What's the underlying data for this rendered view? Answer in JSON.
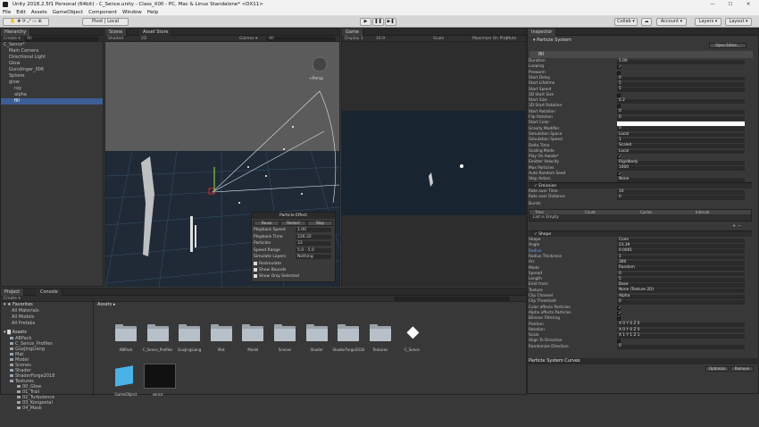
{
  "window": {
    "title": "Unity 2018.2.5f1 Personal (64bit) - C_Sence.unity - Class_X00 - PC, Mac & Linux Standalone* <DX11>"
  },
  "menu": [
    "File",
    "Edit",
    "Assets",
    "GameObject",
    "Component",
    "Window",
    "Help"
  ],
  "toolbar": {
    "pivot": "Pivot",
    "global": "Local",
    "collab": "Collab ▾",
    "account": "Account ▾",
    "layers": "Layers ▾",
    "layout": "Layout ▾"
  },
  "hierarchy": {
    "tab": "Hierarchy",
    "create": "Create ▾",
    "search": "All",
    "items": [
      {
        "label": "C_Sence*",
        "indent": 0
      },
      {
        "label": "Main Camera",
        "indent": 1
      },
      {
        "label": "Directional Light",
        "indent": 1
      },
      {
        "label": "Glow",
        "indent": 1
      },
      {
        "label": "Gunslinger_006",
        "indent": 1
      },
      {
        "label": "Sphere",
        "indent": 1
      },
      {
        "label": "glow",
        "indent": 1
      },
      {
        "label": "ray",
        "indent": 2
      },
      {
        "label": "alpha",
        "indent": 2
      },
      {
        "label": "fill",
        "indent": 2,
        "selected": true
      }
    ]
  },
  "scene": {
    "tab": "Scene",
    "tab2": "Asset Store",
    "shading": "Shaded",
    "mode": "2D",
    "gizmos": "Gizmos ▾",
    "search": "All",
    "persp": "<Persp"
  },
  "game": {
    "tab": "Game",
    "display": "Display 1",
    "aspect": "16:9",
    "scale": "Scale",
    "maximize": "Maximize On Play",
    "mute": "Mute Audio"
  },
  "particle_effect": {
    "title": "Particle Effect",
    "pause": "Pause",
    "restart": "Restart",
    "stop": "Stop",
    "rows": [
      {
        "label": "Playback Speed",
        "value": "1.00"
      },
      {
        "label": "Playback Time",
        "value": "226.32"
      },
      {
        "label": "Particles",
        "value": "33"
      },
      {
        "label": "Speed Range",
        "value": "5.0 - 5.0"
      },
      {
        "label": "Simulate Layers",
        "value": "Nothing"
      }
    ],
    "checks": [
      "Resimulate",
      "Show Bounds",
      "Show Only Selected"
    ]
  },
  "inspector": {
    "tab": "Inspector",
    "component": "Particle System",
    "open_editor": "Open Editor...",
    "module_name": "fill",
    "rows": [
      {
        "label": "Duration",
        "value": "5.00"
      },
      {
        "label": "Looping",
        "check": true
      },
      {
        "label": "Prewarm",
        "check": false
      },
      {
        "label": "Start Delay",
        "value": "0"
      },
      {
        "label": "Start Lifetime",
        "value": "5"
      },
      {
        "label": "Start Speed",
        "value": "5"
      },
      {
        "label": "3D Start Size",
        "check": false
      },
      {
        "label": "Start Size",
        "value": "0.2"
      },
      {
        "label": "3D Start Rotation",
        "check": false
      },
      {
        "label": "Start Rotation",
        "value": "0"
      },
      {
        "label": "Flip Rotation",
        "value": "0"
      },
      {
        "label": "Start Color",
        "value": ""
      },
      {
        "label": "Gravity Modifier",
        "value": "0"
      },
      {
        "label": "Simulation Space",
        "value": "Local"
      },
      {
        "label": "Simulation Speed",
        "value": "1"
      },
      {
        "label": "Delta Time",
        "value": "Scaled"
      },
      {
        "label": "Scaling Mode",
        "value": "Local"
      },
      {
        "label": "Play On Awake*",
        "check": true
      },
      {
        "label": "Emitter Velocity",
        "value": "Rigidbody"
      },
      {
        "label": "Max Particles",
        "value": "1000"
      },
      {
        "label": "Auto Random Seed",
        "check": true
      },
      {
        "label": "Stop Action",
        "value": "None"
      }
    ],
    "emission_title": "Emission",
    "emission_rows": [
      {
        "label": "Rate over Time",
        "value": "10"
      },
      {
        "label": "Rate over Distance",
        "value": "0"
      }
    ],
    "bursts_label": "Bursts",
    "bursts_cols": [
      "Time",
      "Count",
      "Cycles",
      "Interval"
    ],
    "bursts_empty": "List is Empty",
    "shape_title": "Shape",
    "shape_rows": [
      {
        "label": "Shape",
        "value": "Cone"
      },
      {
        "label": "Angle",
        "value": "23.39"
      },
      {
        "label": "Radius",
        "value": "0.0001"
      },
      {
        "label": "Radius Thickness",
        "value": "1"
      },
      {
        "label": "Arc",
        "value": "360"
      },
      {
        "label": "Mode",
        "value": "Random"
      },
      {
        "label": "Spread",
        "value": "0"
      },
      {
        "label": "Length",
        "value": "5"
      },
      {
        "label": "Emit from:",
        "value": "Base"
      },
      {
        "label": "Texture",
        "value": "None (Texture 2D)"
      },
      {
        "label": "Clip Channel",
        "value": "Alpha"
      },
      {
        "label": "Clip Threshold",
        "value": "0"
      },
      {
        "label": "Color affects Particles",
        "check": true
      },
      {
        "label": "Alpha affects Particles",
        "check": true
      },
      {
        "label": "Bilinear Filtering",
        "check": false
      },
      {
        "label": "Position",
        "value": "X 0    Y 0    Z 0"
      },
      {
        "label": "Rotation",
        "value": "X 0    Y 0    Z 0"
      },
      {
        "label": "Scale",
        "value": "X 1    Y 1    Z 1"
      },
      {
        "label": "Align To Direction",
        "check": false
      },
      {
        "label": "Randomize Direction",
        "value": "0"
      }
    ],
    "curves_title": "Particle System Curves",
    "curves_btns": [
      "Optimize",
      "Remove"
    ]
  },
  "project": {
    "tab": "Project",
    "tab2": "Console",
    "create": "Create ▾",
    "favorites_title": "Favorites",
    "favorites": [
      "All Materials",
      "All Models",
      "All Prefabs"
    ],
    "assets_title": "Assets",
    "tree": [
      "ABPack",
      "C_Sence_Profiles",
      "GuoJingLiang",
      "Mat",
      "Model",
      "Scenes",
      "Shader",
      "ShaderForge2018",
      "Textures",
      "00_Glow",
      "01_Trail",
      "02_Turbulence",
      "03_Kongeetal",
      "04_Mask"
    ],
    "breadcrumb": "Assets ▸",
    "assets": [
      "ABPack",
      "C_Sence_Profiles",
      "GuoJingLiang",
      "Mat",
      "Model",
      "Scenes",
      "Shader",
      "ShaderForge2018",
      "Textures",
      "C_Sence",
      "GameObject",
      "sence"
    ]
  }
}
